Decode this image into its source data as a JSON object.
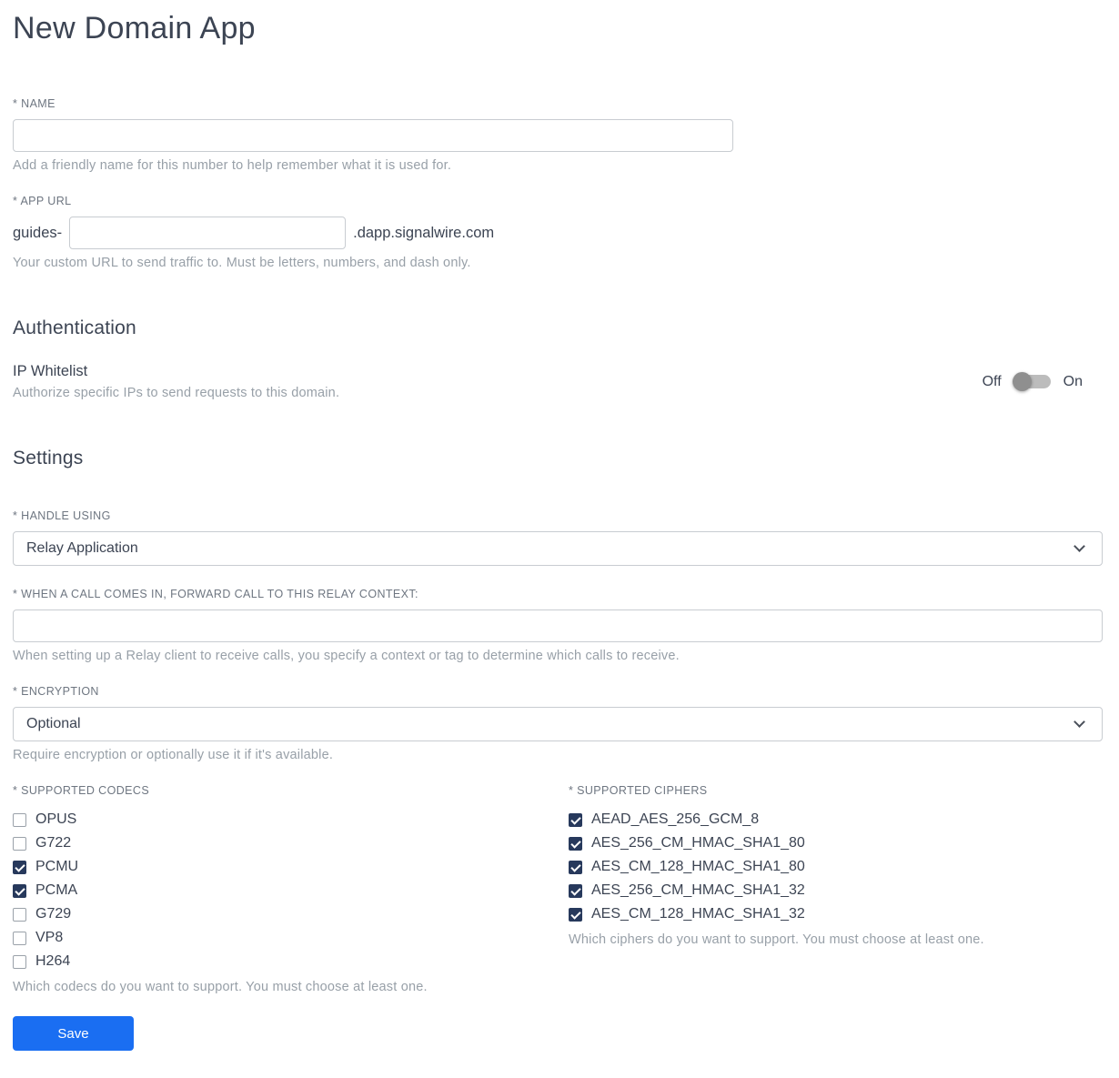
{
  "page": {
    "title": "New Domain App"
  },
  "name_field": {
    "label": "* NAME",
    "value": "",
    "help": "Add a friendly name for this number to help remember what it is used for."
  },
  "app_url_field": {
    "label": "* APP URL",
    "prefix": "guides-",
    "value": "",
    "suffix": ".dapp.signalwire.com",
    "help": "Your custom URL to send traffic to. Must be letters, numbers, and dash only."
  },
  "authentication": {
    "heading": "Authentication",
    "ip_whitelist": {
      "label": "IP Whitelist",
      "help": "Authorize specific IPs to send requests to this domain.",
      "off_label": "Off",
      "on_label": "On",
      "state": "off"
    }
  },
  "settings": {
    "heading": "Settings",
    "handle_using": {
      "label": "* HANDLE USING",
      "value": "Relay Application"
    },
    "relay_context": {
      "label": "* WHEN A CALL COMES IN, FORWARD CALL TO THIS RELAY CONTEXT:",
      "value": "",
      "help": "When setting up a Relay client to receive calls, you specify a context or tag to determine which calls to receive."
    },
    "encryption": {
      "label": "* ENCRYPTION",
      "value": "Optional",
      "help": "Require encryption or optionally use it if it's available."
    },
    "codecs": {
      "label": "* SUPPORTED CODECS",
      "items": [
        {
          "label": "OPUS",
          "checked": false
        },
        {
          "label": "G722",
          "checked": false
        },
        {
          "label": "PCMU",
          "checked": true
        },
        {
          "label": "PCMA",
          "checked": true
        },
        {
          "label": "G729",
          "checked": false
        },
        {
          "label": "VP8",
          "checked": false
        },
        {
          "label": "H264",
          "checked": false
        }
      ],
      "help": "Which codecs do you want to support. You must choose at least one."
    },
    "ciphers": {
      "label": "* SUPPORTED CIPHERS",
      "items": [
        {
          "label": "AEAD_AES_256_GCM_8",
          "checked": true
        },
        {
          "label": "AES_256_CM_HMAC_SHA1_80",
          "checked": true
        },
        {
          "label": "AES_CM_128_HMAC_SHA1_80",
          "checked": true
        },
        {
          "label": "AES_256_CM_HMAC_SHA1_32",
          "checked": true
        },
        {
          "label": "AES_CM_128_HMAC_SHA1_32",
          "checked": true
        }
      ],
      "help": "Which ciphers do you want to support. You must choose at least one."
    }
  },
  "actions": {
    "save_label": "Save"
  },
  "colors": {
    "accent": "#1a6ef2",
    "checkbox_checked": "#27395c",
    "text_primary": "#3c4453",
    "text_muted": "#98a0a8"
  }
}
